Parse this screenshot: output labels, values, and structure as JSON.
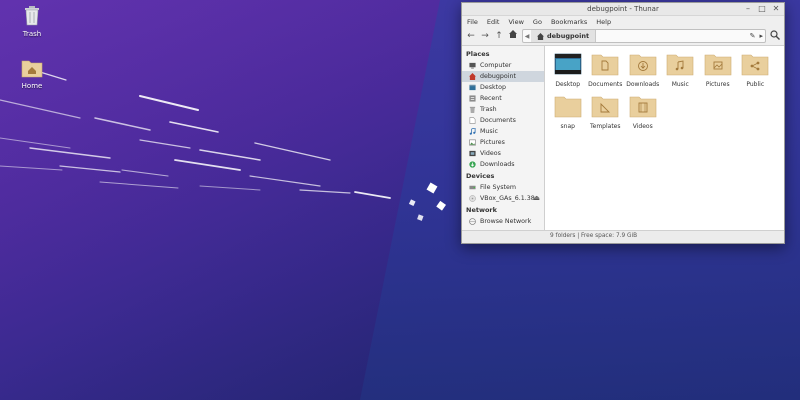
{
  "desktop": {
    "icons": [
      {
        "label": "Trash",
        "icon": "trash-icon"
      },
      {
        "label": "Home",
        "icon": "home-folder-icon"
      }
    ]
  },
  "window": {
    "title": "debugpoint - Thunar",
    "controls": [
      "–",
      "□",
      "✕"
    ],
    "menu": [
      "File",
      "Edit",
      "View",
      "Go",
      "Bookmarks",
      "Help"
    ],
    "path": {
      "current": "debugpoint"
    },
    "sidebar": {
      "places_header": "Places",
      "places": [
        {
          "label": "Computer",
          "icon": "computer-icon"
        },
        {
          "label": "debugpoint",
          "icon": "home-icon",
          "selected": true
        },
        {
          "label": "Desktop",
          "icon": "desktop-icon"
        },
        {
          "label": "Recent",
          "icon": "recent-icon"
        },
        {
          "label": "Trash",
          "icon": "trash-icon"
        },
        {
          "label": "Documents",
          "icon": "documents-icon"
        },
        {
          "label": "Music",
          "icon": "music-icon"
        },
        {
          "label": "Pictures",
          "icon": "pictures-icon"
        },
        {
          "label": "Videos",
          "icon": "videos-icon"
        },
        {
          "label": "Downloads",
          "icon": "downloads-icon"
        }
      ],
      "devices_header": "Devices",
      "devices": [
        {
          "label": "File System",
          "icon": "drive-icon"
        },
        {
          "label": "VBox_GAs_6.1.38",
          "icon": "disc-icon"
        }
      ],
      "network_header": "Network",
      "network": [
        {
          "label": "Browse Network",
          "icon": "network-icon"
        }
      ]
    },
    "files": [
      {
        "name": "Desktop",
        "icon": "desktop-folder-icon"
      },
      {
        "name": "Documents",
        "icon": "documents-folder-icon"
      },
      {
        "name": "Downloads",
        "icon": "downloads-folder-icon"
      },
      {
        "name": "Music",
        "icon": "music-folder-icon"
      },
      {
        "name": "Pictures",
        "icon": "pictures-folder-icon"
      },
      {
        "name": "Public",
        "icon": "public-folder-icon"
      },
      {
        "name": "snap",
        "icon": "folder-icon"
      },
      {
        "name": "Templates",
        "icon": "templates-folder-icon"
      },
      {
        "name": "Videos",
        "icon": "videos-folder-icon"
      }
    ],
    "status": "9 folders  |  Free space: 7.9 GiB"
  },
  "colors": {
    "folder": "#e9cf9d",
    "folder_dark": "#d8b97f",
    "accent": "#4a2a9a"
  }
}
